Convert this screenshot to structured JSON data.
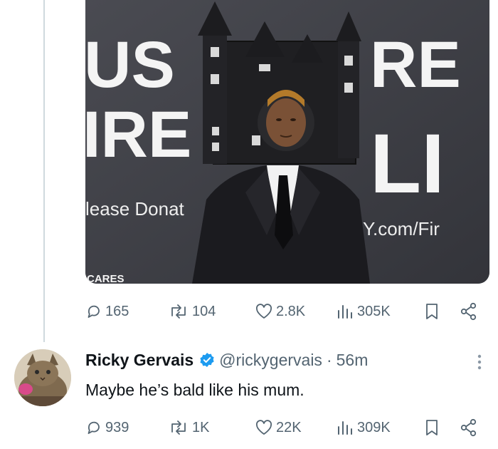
{
  "media": {
    "backdrop_words": [
      "US",
      "RE",
      "IRE",
      "LI"
    ],
    "donate_text": "lease Donat",
    "url_text": "Y.com/Fir",
    "logo_text": "CARES"
  },
  "original_post": {
    "replies": "165",
    "reposts": "104",
    "likes": "2.8K",
    "views": "305K"
  },
  "reply": {
    "display_name": "Ricky Gervais",
    "handle": "@rickygervais",
    "separator": "·",
    "time": "56m",
    "text": "Maybe he’s bald like his mum.",
    "stats": {
      "replies": "939",
      "reposts": "1K",
      "likes": "22K",
      "views": "309K"
    }
  },
  "colors": {
    "muted": "#536471",
    "verified": "#1d9bf0",
    "thread_line": "#cfd9de"
  },
  "icons": [
    "reply-icon",
    "repost-icon",
    "like-icon",
    "views-icon",
    "bookmark-icon",
    "share-icon",
    "verified-badge-icon",
    "more-icon"
  ]
}
